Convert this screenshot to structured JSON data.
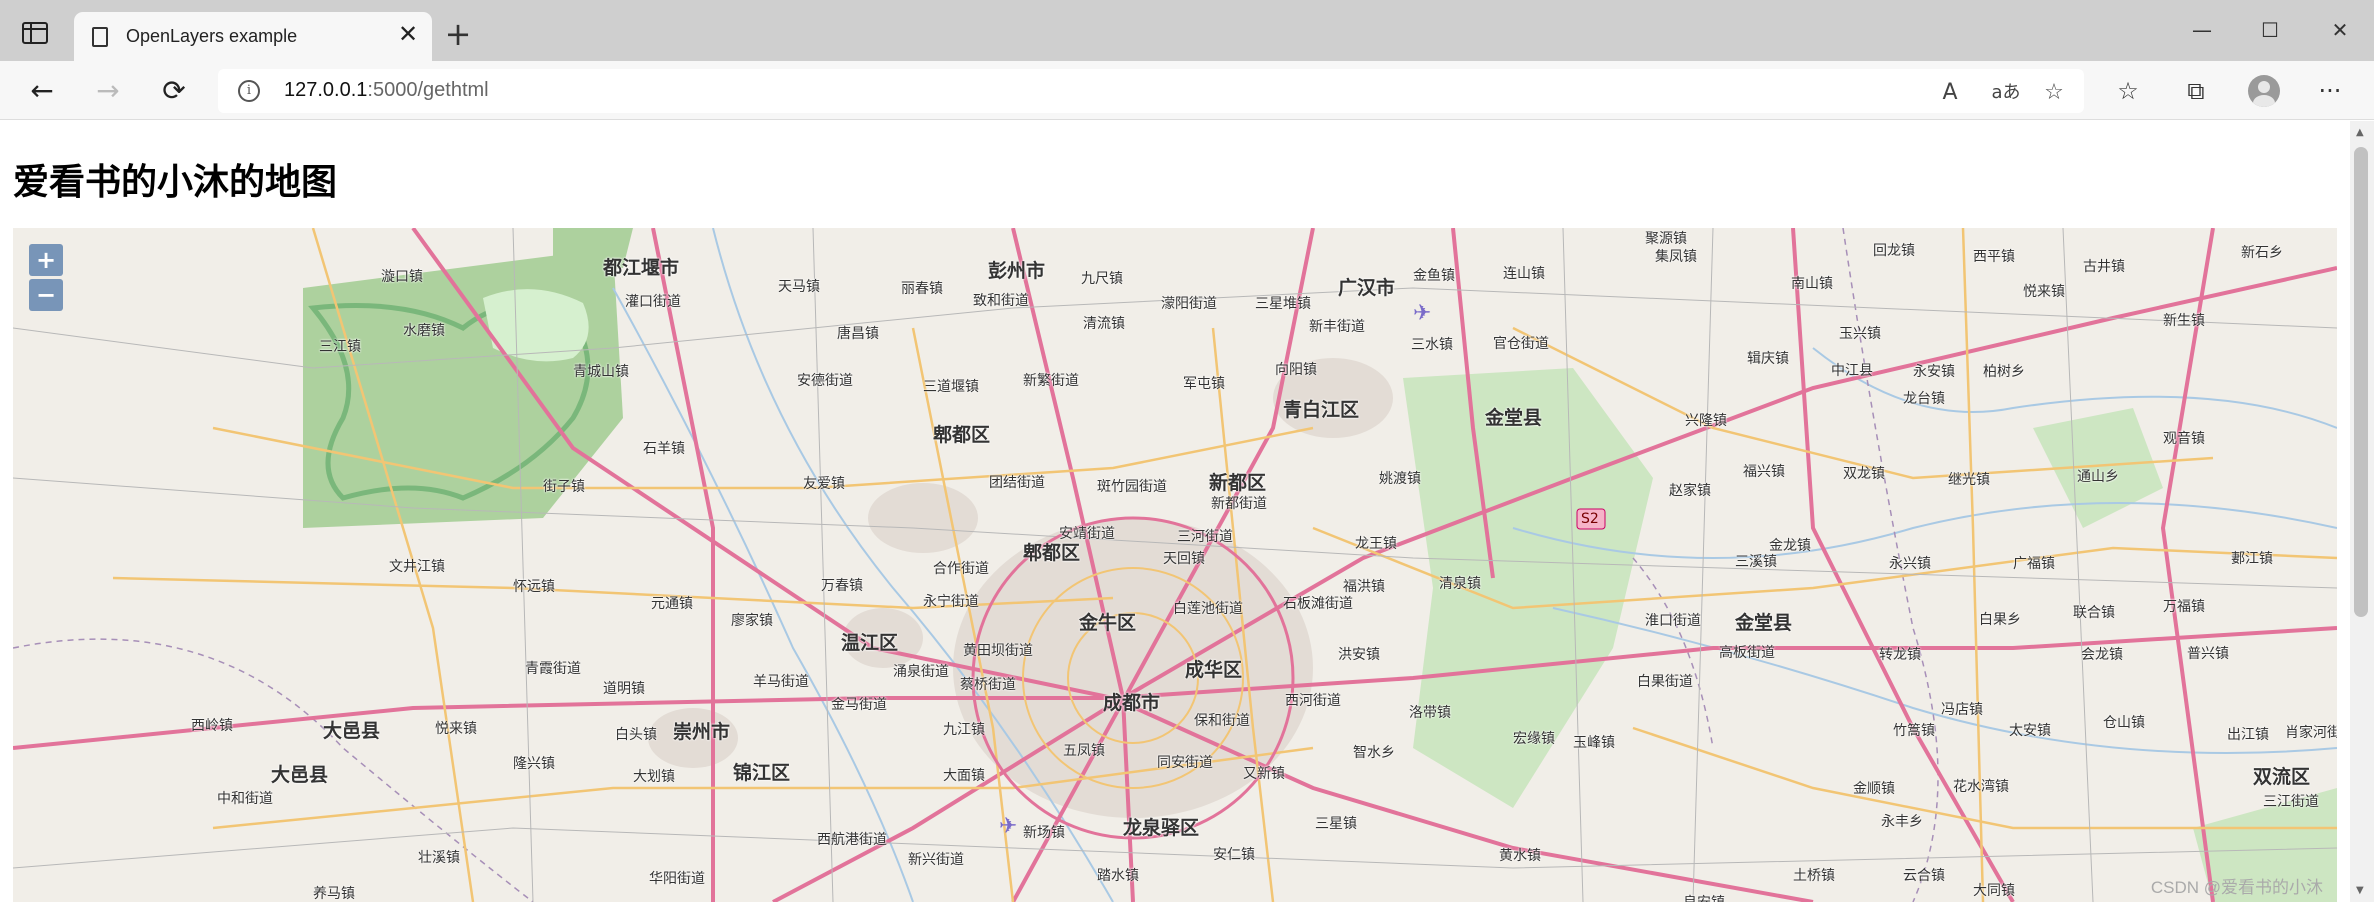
{
  "browser": {
    "tab_title": "OpenLayers example",
    "tab_close": "✕",
    "new_tab": "+",
    "address_host": "127.0.0.1",
    "address_path": ":5000/gethtml",
    "minimize": "—",
    "maximize": "☐",
    "close": "✕",
    "back": "←",
    "forward": "→",
    "reload": "⟳",
    "read_aloud": "A",
    "translate": "aあ",
    "add_favorite": "☆",
    "favorites": "☆",
    "collections": "⧉",
    "more": "···"
  },
  "page": {
    "heading": "爱看书的小沐的地图"
  },
  "map": {
    "zoom_in": "+",
    "zoom_out": "−",
    "attribution": "CSDN @爱看书的小沐",
    "labels": [
      {
        "text": "都江堰市"
      },
      {
        "text": "彭州市"
      },
      {
        "text": "广汉市"
      },
      {
        "text": "天马镇"
      },
      {
        "text": "丽春镇"
      },
      {
        "text": "九尺镇"
      },
      {
        "text": "三星堆镇"
      },
      {
        "text": "金鱼镇"
      },
      {
        "text": "连山镇"
      },
      {
        "text": "集凤镇"
      },
      {
        "text": "回龙镇"
      },
      {
        "text": "西平镇"
      },
      {
        "text": "古井镇"
      },
      {
        "text": "新石乡"
      },
      {
        "text": "漩口镇"
      },
      {
        "text": "聚源镇"
      },
      {
        "text": "致和街道"
      },
      {
        "text": "濛阳街道"
      },
      {
        "text": "南山镇"
      },
      {
        "text": "悦来镇"
      },
      {
        "text": "灌口街道"
      },
      {
        "text": "唐昌镇"
      },
      {
        "text": "清流镇"
      },
      {
        "text": "新丰街道"
      },
      {
        "text": "三水镇"
      },
      {
        "text": "官仓街道"
      },
      {
        "text": "玉兴镇"
      },
      {
        "text": "新生镇"
      },
      {
        "text": "三江镇"
      },
      {
        "text": "水磨镇"
      },
      {
        "text": "青城山镇"
      },
      {
        "text": "安德街道"
      },
      {
        "text": "三道堰镇"
      },
      {
        "text": "新繁街道"
      },
      {
        "text": "军屯镇"
      },
      {
        "text": "向阳镇"
      },
      {
        "text": "辑庆镇"
      },
      {
        "text": "中江县"
      },
      {
        "text": "永安镇"
      },
      {
        "text": "柏树乡"
      },
      {
        "text": "青白江区"
      },
      {
        "text": "金堂县"
      },
      {
        "text": "兴隆镇"
      },
      {
        "text": "龙台镇"
      },
      {
        "text": "石羊镇"
      },
      {
        "text": "郫都区"
      },
      {
        "text": "观音镇"
      },
      {
        "text": "街子镇"
      },
      {
        "text": "友爱镇"
      },
      {
        "text": "团结街道"
      },
      {
        "text": "斑竹园街道"
      },
      {
        "text": "新都区"
      },
      {
        "text": "姚渡镇"
      },
      {
        "text": "赵家镇"
      },
      {
        "text": "福兴镇"
      },
      {
        "text": "双龙镇"
      },
      {
        "text": "继光镇"
      },
      {
        "text": "通山乡"
      },
      {
        "text": "新都街道"
      },
      {
        "text": "S2"
      },
      {
        "text": "郫都区"
      },
      {
        "text": "安靖街道"
      },
      {
        "text": "三河街道"
      },
      {
        "text": "龙王镇"
      },
      {
        "text": "金龙镇"
      },
      {
        "text": "文井江镇"
      },
      {
        "text": "合作街道"
      },
      {
        "text": "天回镇"
      },
      {
        "text": "三溪镇"
      },
      {
        "text": "永兴镇"
      },
      {
        "text": "广福镇"
      },
      {
        "text": "郪江镇"
      },
      {
        "text": "怀远镇"
      },
      {
        "text": "万春镇"
      },
      {
        "text": "永宁街道"
      },
      {
        "text": "福洪镇"
      },
      {
        "text": "清泉镇"
      },
      {
        "text": "元通镇"
      },
      {
        "text": "金牛区"
      },
      {
        "text": "白莲池街道"
      },
      {
        "text": "石板滩街道"
      },
      {
        "text": "淮口街道"
      },
      {
        "text": "金堂县"
      },
      {
        "text": "白果乡"
      },
      {
        "text": "联合镇"
      },
      {
        "text": "万福镇"
      },
      {
        "text": "廖家镇"
      },
      {
        "text": "温江区"
      },
      {
        "text": "黄田坝街道"
      },
      {
        "text": "成华区"
      },
      {
        "text": "洪安镇"
      },
      {
        "text": "高板街道"
      },
      {
        "text": "转龙镇"
      },
      {
        "text": "会龙镇"
      },
      {
        "text": "普兴镇"
      },
      {
        "text": "青霞街道"
      },
      {
        "text": "涌泉街道"
      },
      {
        "text": "蔡桥街道"
      },
      {
        "text": "成都市"
      },
      {
        "text": "白果街道"
      },
      {
        "text": "道明镇"
      },
      {
        "text": "羊马街道"
      },
      {
        "text": "金马街道"
      },
      {
        "text": "西河街道"
      },
      {
        "text": "洛带镇"
      },
      {
        "text": "冯店镇"
      },
      {
        "text": "西岭镇"
      },
      {
        "text": "大邑县"
      },
      {
        "text": "悦来镇"
      },
      {
        "text": "白头镇"
      },
      {
        "text": "崇州市"
      },
      {
        "text": "九江镇"
      },
      {
        "text": "保和街道"
      },
      {
        "text": "竹篙镇"
      },
      {
        "text": "太安镇"
      },
      {
        "text": "仓山镇"
      },
      {
        "text": "肖家河街道"
      },
      {
        "text": "五凤镇"
      },
      {
        "text": "宏缘镇"
      },
      {
        "text": "玉峰镇"
      },
      {
        "text": "出江镇"
      },
      {
        "text": "大邑县"
      },
      {
        "text": "隆兴镇"
      },
      {
        "text": "大划镇"
      },
      {
        "text": "锦江区"
      },
      {
        "text": "同安街道"
      },
      {
        "text": "智水乡"
      },
      {
        "text": "双流区"
      },
      {
        "text": "大面镇"
      },
      {
        "text": "又新镇"
      },
      {
        "text": "金顺镇"
      },
      {
        "text": "花水湾镇"
      },
      {
        "text": "中和街道"
      },
      {
        "text": "龙泉驿区"
      },
      {
        "text": "三星镇"
      },
      {
        "text": "永丰乡"
      },
      {
        "text": "三江街道"
      },
      {
        "text": "西航港街道"
      },
      {
        "text": "新场镇"
      },
      {
        "text": "壮溪镇"
      },
      {
        "text": "黄水镇"
      },
      {
        "text": "新兴街道"
      },
      {
        "text": "安仁镇"
      },
      {
        "text": "华阳街道"
      },
      {
        "text": "踏水镇"
      },
      {
        "text": "土桥镇"
      },
      {
        "text": "云合镇"
      },
      {
        "text": "大同镇"
      },
      {
        "text": "养马镇"
      },
      {
        "text": "良安镇"
      }
    ]
  }
}
